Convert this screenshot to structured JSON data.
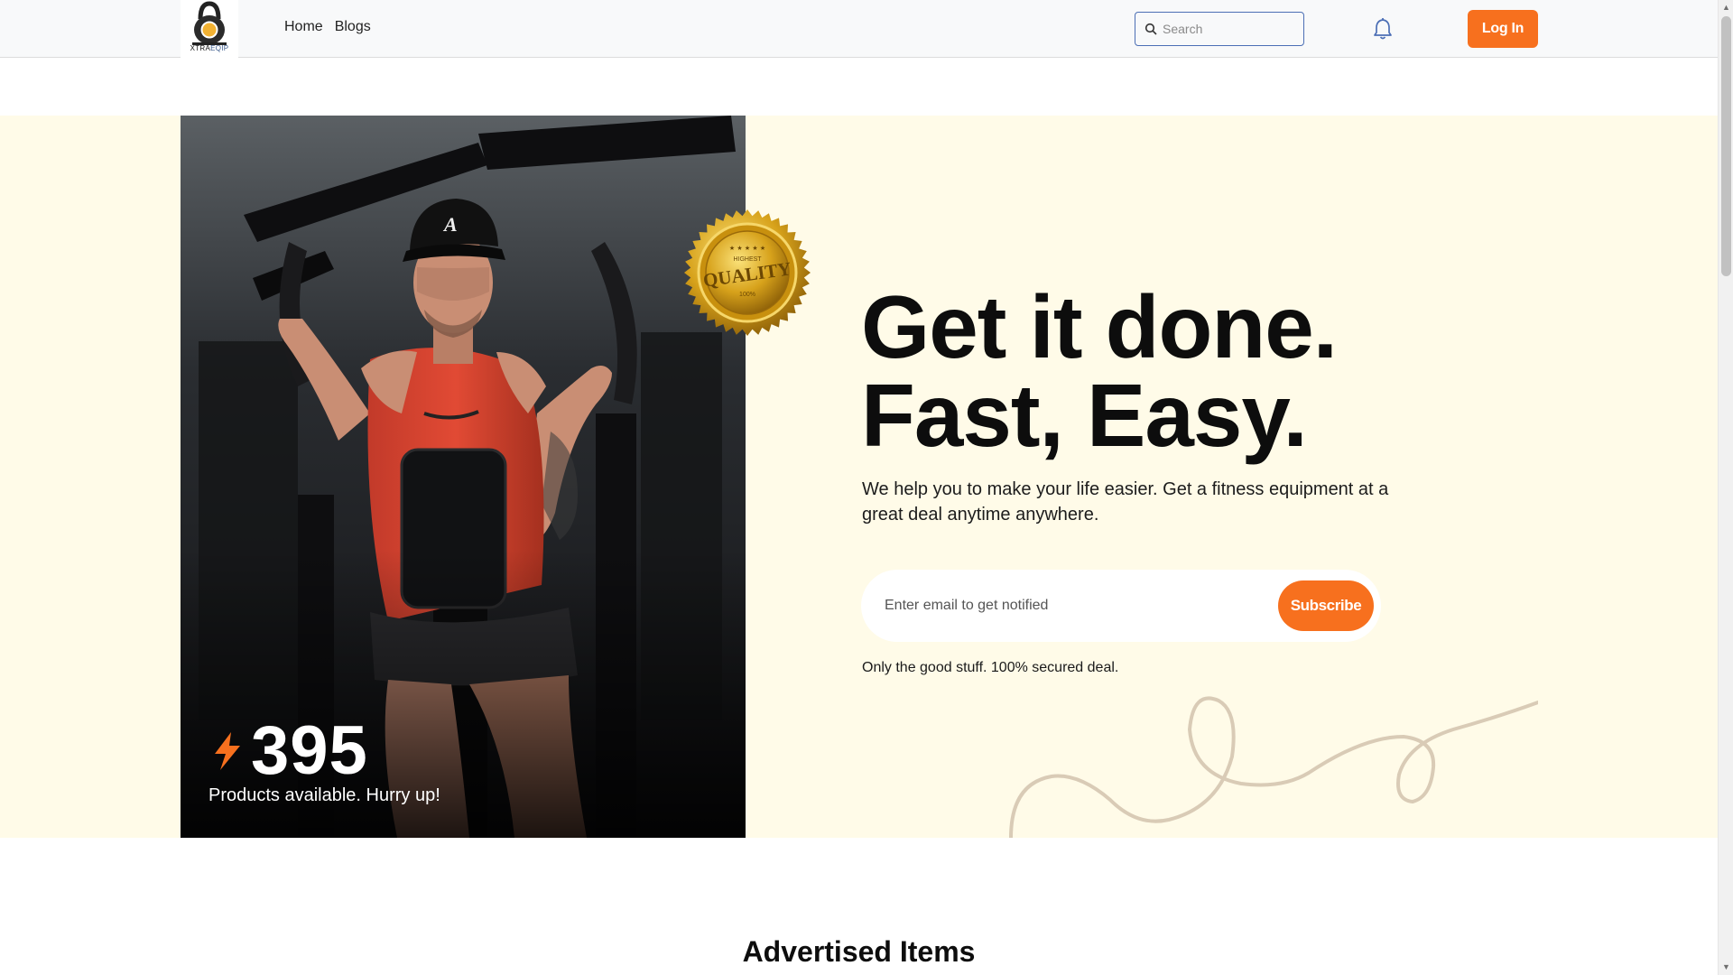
{
  "header": {
    "logo": {
      "brand_main": "XTRA",
      "brand_accent": "EQIP"
    },
    "nav": {
      "home": "Home",
      "blogs": "Blogs"
    },
    "search": {
      "placeholder": "Search"
    },
    "login_label": "Log In",
    "accent_color": "#f7701e"
  },
  "hero": {
    "headline_line1": "Get it done.",
    "headline_line2": "Fast, Easy.",
    "lead": "We help you to make your life easier. Get a fitness equipment at a great deal anytime anywhere.",
    "email": {
      "placeholder": "Enter email to get notified"
    },
    "subscribe_label": "Subscribe",
    "fine_print": "Only the good stuff. 100% secured deal.",
    "stat": {
      "count": "395",
      "label": "Products available. Hurry up!",
      "icon": "bolt-icon"
    },
    "badge": {
      "top": "HIGHEST",
      "main": "QUALITY",
      "bottom": "100%"
    },
    "background_color": "#fffbe8"
  },
  "sections": {
    "advertised_title": "Advertised Items"
  }
}
